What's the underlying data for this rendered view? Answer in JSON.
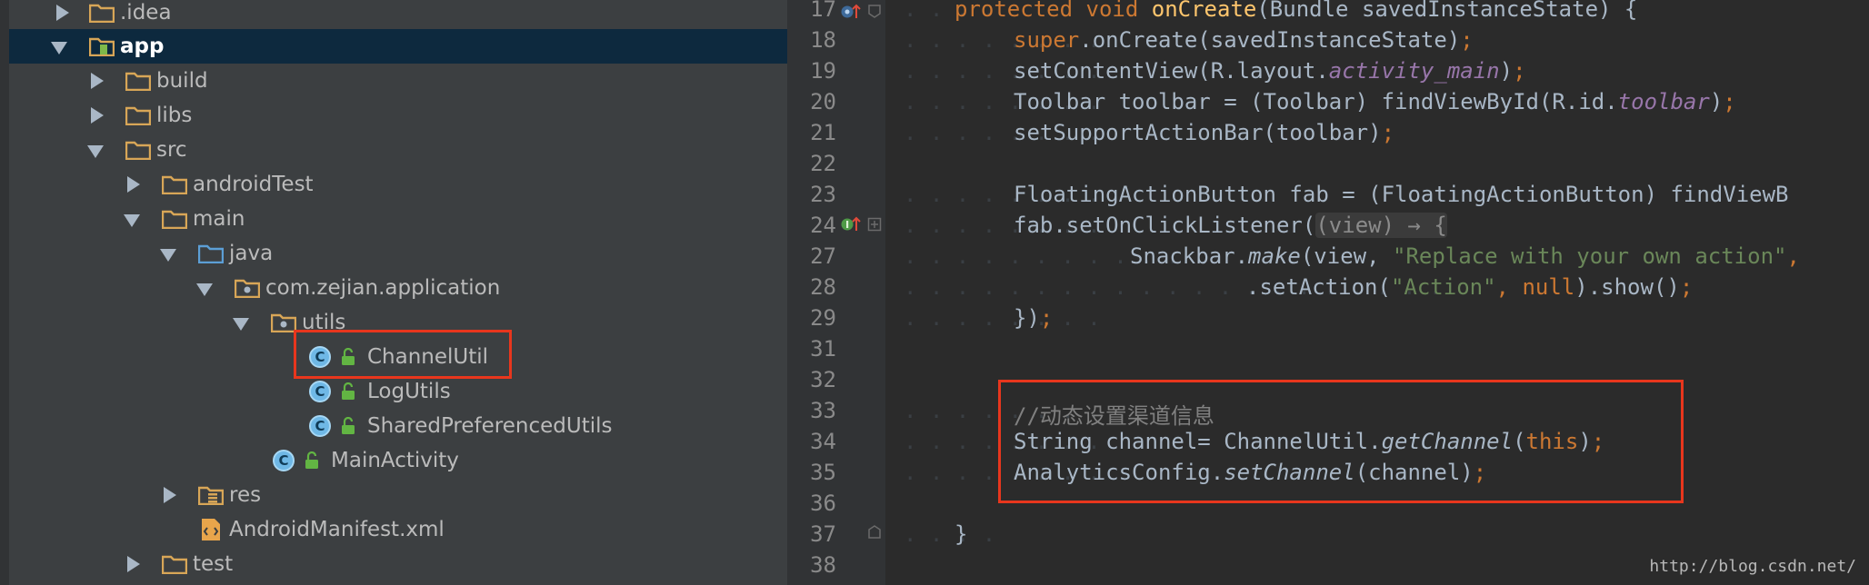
{
  "project_tree": {
    "items": [
      {
        "label": ".idea"
      },
      {
        "label": "app"
      },
      {
        "label": "build"
      },
      {
        "label": "libs"
      },
      {
        "label": "src"
      },
      {
        "label": "androidTest"
      },
      {
        "label": "main"
      },
      {
        "label": "java"
      },
      {
        "label": "com.zejian.application"
      },
      {
        "label": "utils"
      },
      {
        "label": "ChannelUtil"
      },
      {
        "label": "LogUtils"
      },
      {
        "label": "SharedPreferencedUtils"
      },
      {
        "label": "MainActivity"
      },
      {
        "label": "res"
      },
      {
        "label": "AndroidManifest.xml"
      },
      {
        "label": "test"
      }
    ],
    "class_badge": "C"
  },
  "editor": {
    "line_numbers": [
      "17",
      "18",
      "19",
      "20",
      "21",
      "22",
      "23",
      "24",
      "27",
      "28",
      "29",
      "31",
      "32",
      "33",
      "34",
      "35",
      "36",
      "37",
      "38"
    ],
    "tokens": {
      "l17_kw1": "protected",
      "l17_kw2": "void",
      "l17_fn": "onCreate",
      "l17_rest": "(Bundle savedInstanceState) {",
      "l18_kw": "super",
      "l18_rest": ".onCreate(savedInstanceState)",
      "l18_semi": ";",
      "l19_a": "setContentView(R.layout.",
      "l19_fld": "activity_main",
      "l19_b": ")",
      "l19_semi": ";",
      "l20_a": "Toolbar toolbar = (Toolbar) findViewById(R.id.",
      "l20_fld": "toolbar",
      "l20_b": ")",
      "l20_semi": ";",
      "l21_a": "setSupportActionBar(toolbar)",
      "l21_semi": ";",
      "l23_a": "FloatingActionButton fab = (FloatingActionButton) findViewB",
      "l24_a": "fab.setOnClickListener(",
      "l24_hint": "(view) → {",
      "l27_a": "Snackbar.",
      "l27_ita": "make",
      "l27_b": "(view, ",
      "l27_str": "\"Replace with your own action\"",
      "l27_c": ",",
      "l28_a": ".setAction(",
      "l28_str": "\"Action\"",
      "l28_b": ", ",
      "l28_kw": "null",
      "l28_c": ").show()",
      "l28_semi": ";",
      "l29_a": "})",
      "l29_semi": ";",
      "l33_cmt": "//动态设置渠道信息",
      "l34_a": "String channel= ChannelUtil.",
      "l34_ita": "getChannel",
      "l34_b": "(",
      "l34_kw": "this",
      "l34_c": ")",
      "l34_semi": ";",
      "l35_a": "AnalyticsConfig.",
      "l35_ita": "setChannel",
      "l35_b": "(channel)",
      "l35_semi": ";",
      "l37_a": "}"
    },
    "watermark": "http://blog.csdn.net/"
  },
  "colors": {
    "highlight": "#e8361d",
    "keyword": "#cc7832",
    "function": "#ffc66d",
    "string": "#6a8759",
    "field": "#9876aa",
    "folder": "#d8a657",
    "source_folder": "#5c9fd6"
  }
}
